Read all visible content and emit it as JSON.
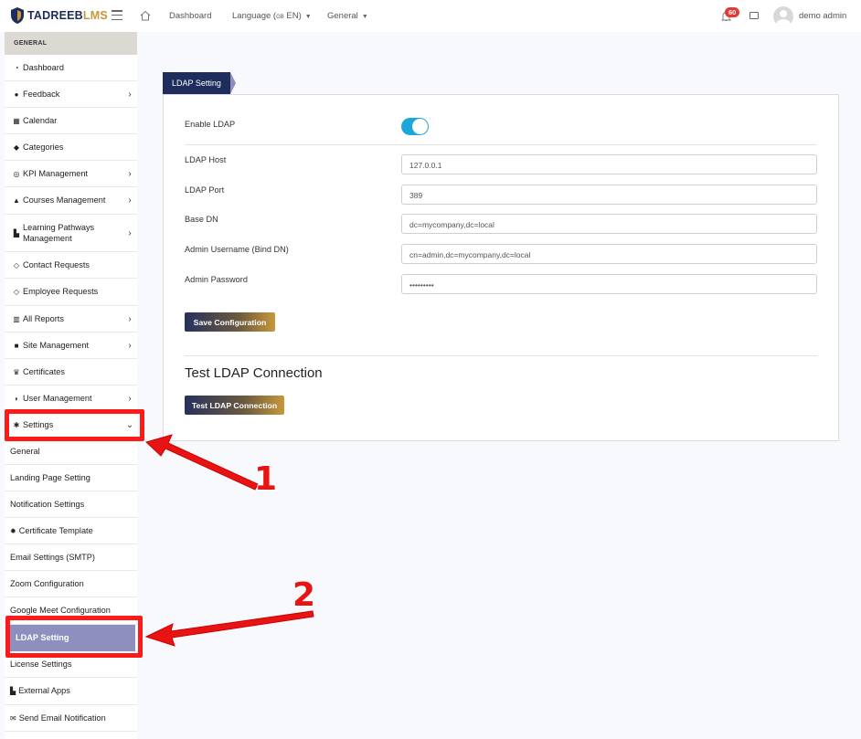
{
  "header": {
    "logo_primary": "TADREEB",
    "logo_secondary": "LMS",
    "nav": {
      "dashboard": "Dashboard",
      "language": "Language",
      "language_flag": "GB",
      "language_code": "EN",
      "general": "General"
    },
    "notification_count": "60",
    "user_name": "demo admin"
  },
  "sidebar": {
    "section": "GENERAL",
    "items": [
      {
        "label": "Dashboard",
        "icon": "gauge-icon"
      },
      {
        "label": "Feedback",
        "icon": "chat-icon"
      },
      {
        "label": "Calendar",
        "icon": "calendar-icon"
      },
      {
        "label": "Categories",
        "icon": "tags-icon"
      },
      {
        "label": "KPI Management",
        "icon": "target-icon"
      },
      {
        "label": "Courses Management",
        "icon": "graduation-cap-icon"
      },
      {
        "label": "Learning Pathways Management",
        "icon": "sitemap-icon"
      },
      {
        "label": "Contact Requests",
        "icon": "tag-icon"
      },
      {
        "label": "Employee Requests",
        "icon": "tag-icon"
      },
      {
        "label": "All Reports",
        "icon": "bar-chart-icon"
      },
      {
        "label": "Site Management",
        "icon": "folder-icon"
      },
      {
        "label": "Certificates",
        "icon": "trophy-icon"
      },
      {
        "label": "User Management",
        "icon": "shield-icon"
      },
      {
        "label": "Settings",
        "icon": "gear-icon"
      }
    ],
    "settings_sub": [
      "General",
      "Landing Page Setting",
      "Notification Settings",
      "Certificate Template",
      "Email Settings (SMTP)",
      "Zoom Configuration",
      "Google Meet Configuration",
      "LDAP Setting",
      "License Settings",
      "External Apps",
      "Send Email Notification"
    ]
  },
  "content": {
    "tab": "LDAP Setting",
    "enable_label": "Enable LDAP",
    "enabled": true,
    "fields": [
      {
        "label": "LDAP Host",
        "value": "127.0.0.1"
      },
      {
        "label": "LDAP Port",
        "value": "389"
      },
      {
        "label": "Base DN",
        "value": "dc=mycompany,dc=local"
      },
      {
        "label": "Admin Username (Bind DN)",
        "value": "cn=admin,dc=mycompany,dc=local"
      },
      {
        "label": "Admin Password",
        "value": "•••••••••"
      }
    ],
    "save_button": "Save Configuration",
    "test_title": "Test LDAP Connection",
    "test_button": "Test LDAP Connection"
  },
  "annotations": {
    "step1": "1",
    "step2": "2",
    "color": "#ff1a1a"
  }
}
